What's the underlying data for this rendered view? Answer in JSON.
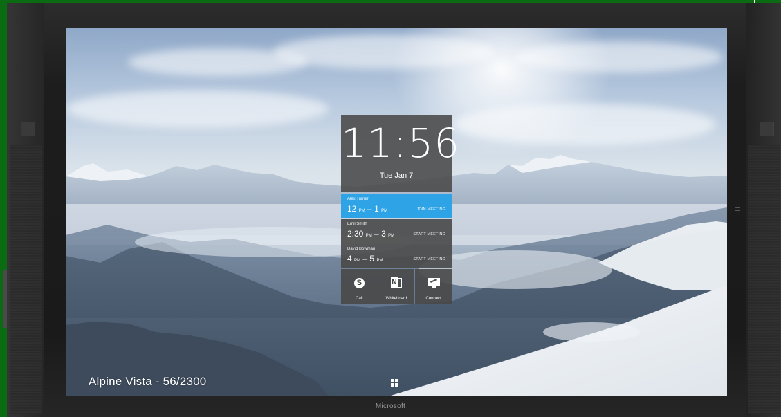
{
  "device": {
    "brand": "Microsoft"
  },
  "lock_screen": {
    "clock": {
      "time": "11:56",
      "date": "Tue Jan 7"
    },
    "meetings": [
      {
        "organizer": "Alex Turner",
        "time_main": "12",
        "time_main_suffix": "PM",
        "time_sep": "–",
        "time_end": "1",
        "time_end_suffix": "PM",
        "action": "JOIN MEETING",
        "active": true
      },
      {
        "organizer": "Emil Smith",
        "time_main": "2:30",
        "time_main_suffix": "PM",
        "time_sep": "–",
        "time_end": "3",
        "time_end_suffix": "PM",
        "action": "START MEETING",
        "active": false
      },
      {
        "organizer": "David Bowman",
        "time_main": "4",
        "time_main_suffix": "PM",
        "time_sep": "–",
        "time_end": "5",
        "time_end_suffix": "PM",
        "action": "START MEETING",
        "active": false
      }
    ],
    "actions": [
      {
        "label": "Call",
        "icon": "skype-icon"
      },
      {
        "label": "Whiteboard",
        "icon": "onenote-icon"
      },
      {
        "label": "Connect",
        "icon": "connect-icon"
      }
    ],
    "caption": "Alpine Vista - 56/2300"
  },
  "colors": {
    "active_meeting": "#2ea4e6",
    "tile": "#484848",
    "bezel": "#1d1d1d",
    "background": "#0b6b12"
  }
}
